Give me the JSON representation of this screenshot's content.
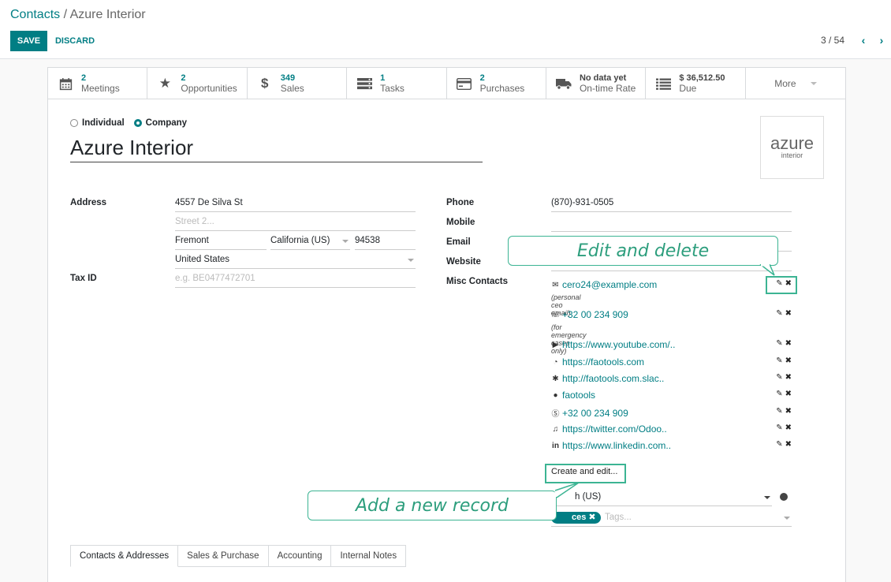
{
  "breadcrumb": {
    "parent": "Contacts",
    "separator": " / ",
    "current": "Azure Interior"
  },
  "toolbar": {
    "save_label": "SAVE",
    "discard_label": "DISCARD"
  },
  "pager": {
    "text": "3 / 54"
  },
  "stats": [
    {
      "value": "2",
      "label": "Meetings",
      "icon": "calendar-icon"
    },
    {
      "value": "2",
      "label": "Opportunities",
      "icon": "star-icon"
    },
    {
      "value": "349",
      "label": "Sales",
      "icon": "dollar-icon"
    },
    {
      "value": "1",
      "label": "Tasks",
      "icon": "tasks-icon"
    },
    {
      "value": "2",
      "label": "Purchases",
      "icon": "credit-card-icon"
    },
    {
      "value": "No data yet",
      "label": "On-time Rate",
      "icon": "truck-icon"
    },
    {
      "value": "$ 36,512.50",
      "label": "Due",
      "icon": "list-icon"
    }
  ],
  "more_label": "More",
  "type_radio": {
    "individual": "Individual",
    "company": "Company"
  },
  "name": "Azure Interior",
  "logo": {
    "line1": "azure",
    "line2": "interior"
  },
  "address": {
    "label": "Address",
    "street": "4557 De Silva St",
    "street2_placeholder": "Street 2...",
    "city": "Fremont",
    "state": "California (US)",
    "zip": "94538",
    "country": "United States"
  },
  "tax": {
    "label": "Tax ID",
    "placeholder": "e.g. BE0477472701"
  },
  "contact": {
    "phone_label": "Phone",
    "phone": "(870)-931-0505",
    "mobile_label": "Mobile",
    "email_label": "Email",
    "website_label": "Website",
    "misc_label": "Misc Contacts"
  },
  "misc_contacts": [
    {
      "icon": "envelope-icon",
      "glyph": "✉",
      "text": "cero24@example.com",
      "note": "(personal ceo email)"
    },
    {
      "icon": "phone-icon",
      "glyph": "☏",
      "text": "+32 00 234 909",
      "note": "(for emergency cases only)"
    },
    {
      "icon": "youtube-icon",
      "glyph": "▶",
      "text": "https://www.youtube.com/.."
    },
    {
      "icon": "whatsapp-icon",
      "glyph": "◔",
      "text": "https://faotools.com"
    },
    {
      "icon": "slack-icon",
      "glyph": "✱",
      "text": "http://faotools.com.slac.."
    },
    {
      "icon": "telegram-icon",
      "glyph": "●",
      "text": "faotools"
    },
    {
      "icon": "skype-icon",
      "glyph": "Ⓢ",
      "text": "+32 00 234 909"
    },
    {
      "icon": "twitter-icon",
      "glyph": "♫",
      "text": "https://twitter.com/Odoo.."
    },
    {
      "icon": "linkedin-icon",
      "glyph": "in",
      "text": "https://www.linkedin.com.."
    }
  ],
  "create_edit": "Create and edit...",
  "language_partial": "h (US)",
  "tag_partial": "ces",
  "tags_placeholder": "Tags...",
  "callouts": {
    "edit": "Edit and delete",
    "add": "Add a new record"
  },
  "tabs": [
    "Contacts & Addresses",
    "Sales & Purchase",
    "Accounting",
    "Internal Notes"
  ],
  "colors": {
    "accent": "#017e84",
    "callout": "#3cb493"
  }
}
